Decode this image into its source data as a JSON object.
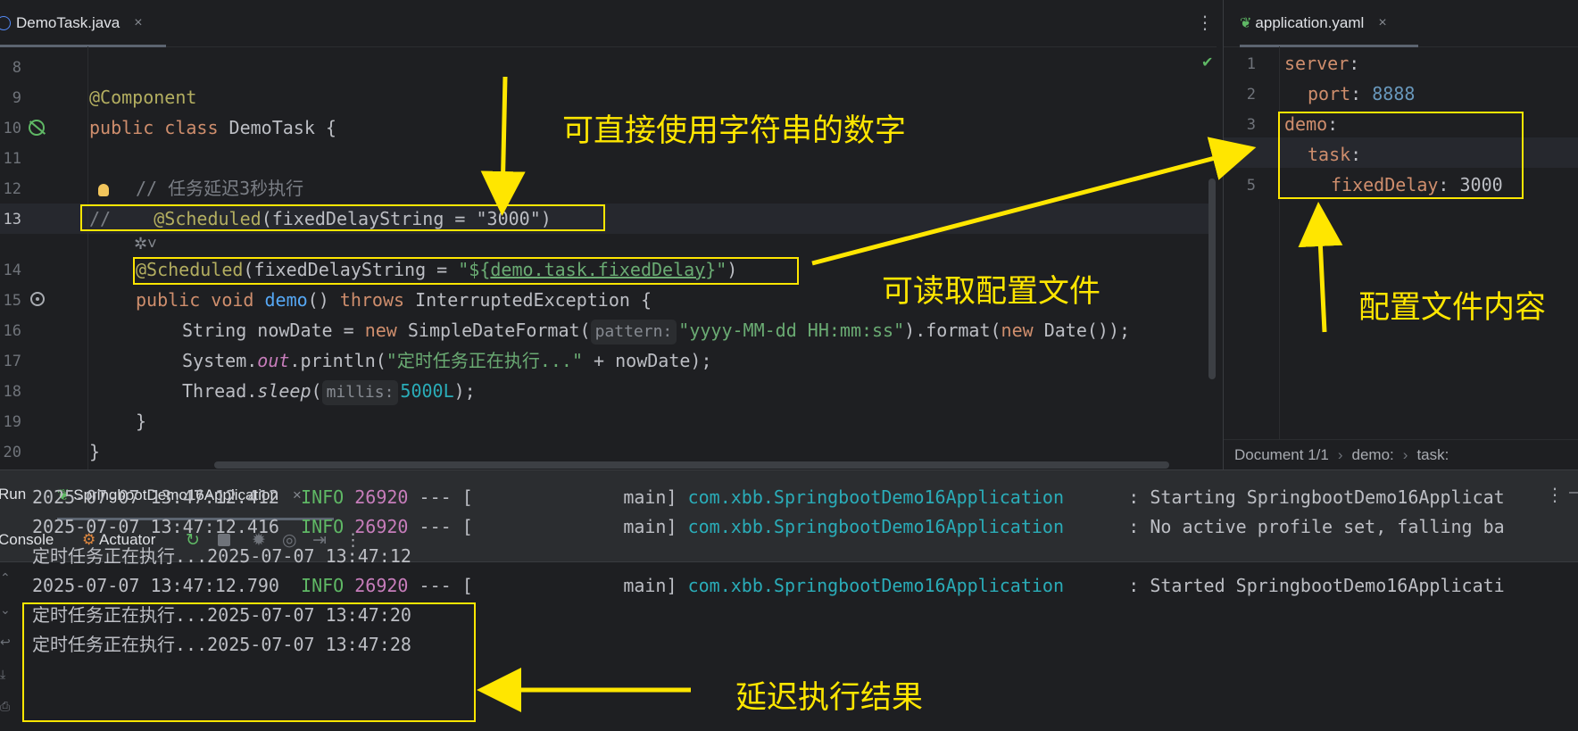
{
  "left_editor": {
    "tab": {
      "title": "DemoTask.java",
      "close": "×"
    },
    "menu_glyph": "⋮",
    "lines": [
      {
        "num": "8"
      },
      {
        "num": "9",
        "annotation": "@Component"
      },
      {
        "num": "10",
        "kw": "public class",
        "name": "DemoTask {"
      },
      {
        "num": "11"
      },
      {
        "num": "12",
        "comment": "// 任务延迟3秒执行"
      },
      {
        "num": "13",
        "prefix": "//",
        "annotation": "@Scheduled",
        "mid": "(fixedDelayString = ",
        "str": "\"3000\"",
        "end": ")"
      },
      {
        "num": "14",
        "annotation": "@Scheduled",
        "mid": "(fixedDelayString = ",
        "str_a": "\"${",
        "placeholder": "demo.task.fixedDelay",
        "str_b": "}\"",
        "end": ")"
      },
      {
        "num": "15",
        "kw1": "public void ",
        "fn": "demo",
        "mid": "() ",
        "kw2": "throws",
        "rest": " InterruptedException {"
      },
      {
        "num": "16",
        "a": "String nowDate = ",
        "kw": "new",
        "b": " SimpleDateFormat(",
        "hint": "pattern:",
        "str": "\"yyyy-MM-dd HH:mm:ss\"",
        "c": ").format(",
        "kw2": "new",
        "d": " Date());"
      },
      {
        "num": "17",
        "a": "System.",
        "fld": "out",
        "b": ".println(",
        "str": "\"定时任务正在执行...\"",
        "c": " + nowDate);"
      },
      {
        "num": "18",
        "a": "Thread.",
        "ital": "sleep",
        "b": "(",
        "hint": "millis:",
        "num_val": "5000L",
        "c": ");"
      },
      {
        "num": "19",
        "text": "}"
      },
      {
        "num": "20",
        "text": "}"
      }
    ]
  },
  "right_editor": {
    "tab": {
      "title": "application.yaml",
      "close": "×"
    },
    "lines": [
      {
        "num": "1",
        "key": "server",
        "colon": ":"
      },
      {
        "num": "2",
        "key": "port",
        "colon": ": ",
        "val": "8888"
      },
      {
        "num": "3",
        "key": "demo",
        "colon": ":"
      },
      {
        "num": "4",
        "key": "task",
        "colon": ":"
      },
      {
        "num": "5",
        "key": "fixedDelay",
        "colon": ": ",
        "val": "3000"
      }
    ],
    "breadcrumb": [
      "Document 1/1",
      "demo:",
      "task:"
    ],
    "breadcrumb_sep": "›"
  },
  "run_panel": {
    "title": "Run",
    "config_tab": "SpringbootDemo16Application",
    "close": "×",
    "menu_glyph": "⋮",
    "minimize_glyph": "—",
    "toolbar": {
      "console": "Console",
      "actuator": "Actuator",
      "more": "⋮"
    },
    "logs": [
      {
        "ts": "2025-07-07 13:47:12.412",
        "level": "INFO",
        "pid": "26920",
        "sep": " --- [",
        "thread": "main]",
        "cls": "com.xbb.SpringbootDemo16Application",
        "msg": ": Starting SpringbootDemo16Applicat"
      },
      {
        "ts": "2025-07-07 13:47:12.416",
        "level": "INFO",
        "pid": "26920",
        "sep": " --- [",
        "thread": "main]",
        "cls": "com.xbb.SpringbootDemo16Application",
        "msg": ": No active profile set, falling ba"
      },
      {
        "plain": "定时任务正在执行...2025-07-07 13:47:12"
      },
      {
        "ts": "2025-07-07 13:47:12.790",
        "level": "INFO",
        "pid": "26920",
        "sep": " --- [",
        "thread": "main]",
        "cls": "com.xbb.SpringbootDemo16Application",
        "msg": ": Started SpringbootDemo16Applicati"
      },
      {
        "plain": "定时任务正在执行...2025-07-07 13:47:20"
      },
      {
        "plain": "定时任务正在执行...2025-07-07 13:47:28"
      }
    ]
  },
  "annotations": {
    "direct_string": "可直接使用字符串的数字",
    "read_config": "可读取配置文件",
    "config_content": "配置文件内容",
    "delay_result": "延迟执行结果"
  },
  "colors": {
    "highlight": "#ffe600",
    "background": "#1e1f22",
    "keyword": "#cf8e6d",
    "annotation": "#b3ae60",
    "string": "#6aab73"
  }
}
